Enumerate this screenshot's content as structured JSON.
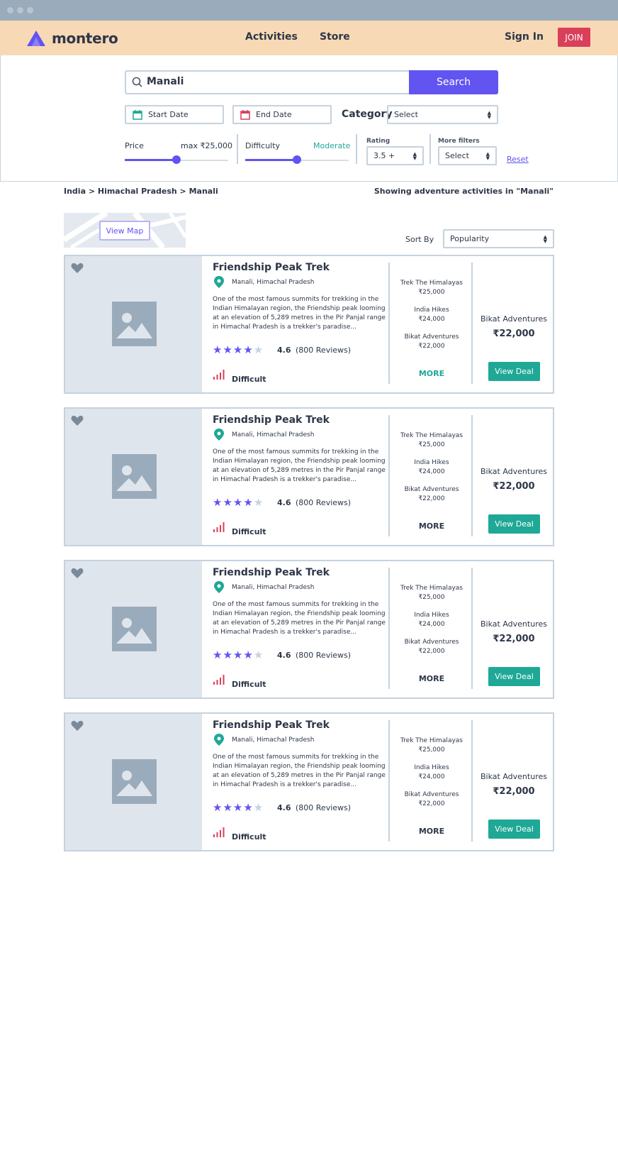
{
  "brand": {
    "name": "montero",
    "accent": "#6254f0"
  },
  "nav": {
    "links": [
      "Activities",
      "Store"
    ],
    "sign_in": "Sign In",
    "join": "JOIN"
  },
  "search": {
    "value": "Manali",
    "button": "Search",
    "start_date": "Start Date",
    "end_date": "End Date",
    "category_label": "Category",
    "category_value": "Select"
  },
  "filters": {
    "price_label": "Price",
    "price_value": "max ₹25,000",
    "price_level": 0.5,
    "difficulty_label": "Difficulty",
    "difficulty_value": "Moderate",
    "difficulty_level": 0.5,
    "rating_label": "Rating",
    "rating_value": "3.5 +",
    "more_filters_label": "More filters",
    "more_filters_value": "Select",
    "reset": "Reset"
  },
  "breadcrumb": "India > Himachal Pradesh > Manali",
  "showing": "Showing adventure activities in \"Manali\"",
  "map": {
    "button": "View Map"
  },
  "sort": {
    "label": "Sort By",
    "value": "Popularity"
  },
  "cards": [
    {
      "title": "Friendship Peak Trek",
      "location": "Manali, Himachal Pradesh",
      "description": "One of the most famous summits for trekking in the Indian Himalayan region, the Friendship peak looming at an elevation of 5,289 metres in the Pir Panjal range in Himachal Pradesh is a trekker's paradise...",
      "stars": 4,
      "rating": "4.6",
      "reviews": "(800 Reviews)",
      "difficulty": "Difficult",
      "vendors": [
        {
          "name": "Trek The Himalayas",
          "price": "₹25,000"
        },
        {
          "name": "India Hikes",
          "price": "₹24,000"
        },
        {
          "name": "Bikat Adventures",
          "price": "₹22,000"
        }
      ],
      "more": "MORE",
      "more_color": "#1fa896",
      "best_vendor": "Bikat Adventures",
      "best_price": "₹22,000",
      "deal_button": "View Deal"
    },
    {
      "title": "Friendship Peak Trek",
      "location": "Manali, Himachal Pradesh",
      "description": "One of the most famous summits for trekking in the Indian Himalayan region, the Friendship peak looming at an elevation of 5,289 metres in the Pir Panjal range in Himachal Pradesh is a trekker's paradise...",
      "stars": 4,
      "rating": "4.6",
      "reviews": "(800 Reviews)",
      "difficulty": "Difficult",
      "vendors": [
        {
          "name": "Trek The Himalayas",
          "price": "₹25,000"
        },
        {
          "name": "India Hikes",
          "price": "₹24,000"
        },
        {
          "name": "Bikat Adventures",
          "price": "₹22,000"
        }
      ],
      "more": "MORE",
      "more_color": "#2d3748",
      "best_vendor": "Bikat Adventures",
      "best_price": "₹22,000",
      "deal_button": "View Deal"
    },
    {
      "title": "Friendship Peak Trek",
      "location": "Manali, Himachal Pradesh",
      "description": "One of the most famous summits for trekking in the Indian Himalayan region, the Friendship peak looming at an elevation of 5,289 metres in the Pir Panjal range in Himachal Pradesh is a trekker's paradise...",
      "stars": 4,
      "rating": "4.6",
      "reviews": "(800 Reviews)",
      "difficulty": "Difficult",
      "vendors": [
        {
          "name": "Trek The Himalayas",
          "price": "₹25,000"
        },
        {
          "name": "India Hikes",
          "price": "₹24,000"
        },
        {
          "name": "Bikat Adventures",
          "price": "₹22,000"
        }
      ],
      "more": "MORE",
      "more_color": "#2d3748",
      "best_vendor": "Bikat Adventures",
      "best_price": "₹22,000",
      "deal_button": "View Deal"
    },
    {
      "title": "Friendship Peak Trek",
      "location": "Manali, Himachal Pradesh",
      "description": "One of the most famous summits for trekking in the Indian Himalayan region, the Friendship peak looming at an elevation of 5,289 metres in the Pir Panjal range in Himachal Pradesh is a trekker's paradise...",
      "stars": 4,
      "rating": "4.6",
      "reviews": "(800 Reviews)",
      "difficulty": "Difficult",
      "vendors": [
        {
          "name": "Trek The Himalayas",
          "price": "₹25,000"
        },
        {
          "name": "India Hikes",
          "price": "₹24,000"
        },
        {
          "name": "Bikat Adventures",
          "price": "₹22,000"
        }
      ],
      "more": "MORE",
      "more_color": "#2d3748",
      "best_vendor": "Bikat Adventures",
      "best_price": "₹22,000",
      "deal_button": "View Deal"
    }
  ],
  "colors": {
    "nav_bg": "#f8d9b5",
    "titlebar": "#9aabbb",
    "join": "#d93f5a",
    "deal": "#1fa896",
    "star_on": "#6254f0",
    "star_off": "#c6d2de",
    "difficulty_icon": "#d93f5a"
  }
}
